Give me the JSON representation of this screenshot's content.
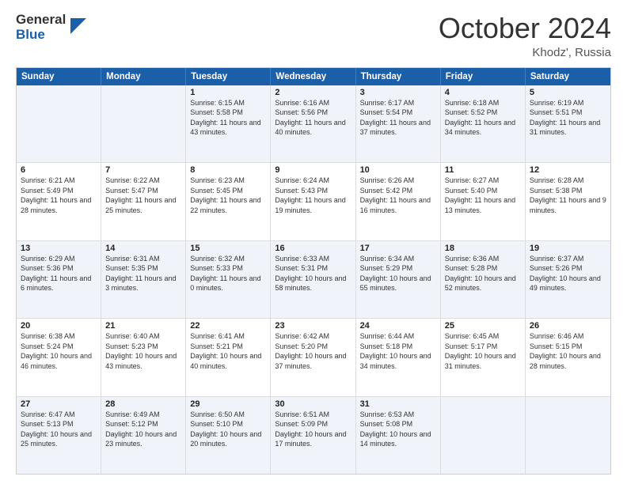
{
  "logo": {
    "line1": "General",
    "line2": "Blue"
  },
  "title": "October 2024",
  "location": "Khodz', Russia",
  "days": [
    "Sunday",
    "Monday",
    "Tuesday",
    "Wednesday",
    "Thursday",
    "Friday",
    "Saturday"
  ],
  "rows": [
    [
      {
        "day": "",
        "sunrise": "",
        "sunset": "",
        "daylight": "",
        "empty": true
      },
      {
        "day": "",
        "sunrise": "",
        "sunset": "",
        "daylight": "",
        "empty": true
      },
      {
        "day": "1",
        "sunrise": "Sunrise: 6:15 AM",
        "sunset": "Sunset: 5:58 PM",
        "daylight": "Daylight: 11 hours and 43 minutes."
      },
      {
        "day": "2",
        "sunrise": "Sunrise: 6:16 AM",
        "sunset": "Sunset: 5:56 PM",
        "daylight": "Daylight: 11 hours and 40 minutes."
      },
      {
        "day": "3",
        "sunrise": "Sunrise: 6:17 AM",
        "sunset": "Sunset: 5:54 PM",
        "daylight": "Daylight: 11 hours and 37 minutes."
      },
      {
        "day": "4",
        "sunrise": "Sunrise: 6:18 AM",
        "sunset": "Sunset: 5:52 PM",
        "daylight": "Daylight: 11 hours and 34 minutes."
      },
      {
        "day": "5",
        "sunrise": "Sunrise: 6:19 AM",
        "sunset": "Sunset: 5:51 PM",
        "daylight": "Daylight: 11 hours and 31 minutes."
      }
    ],
    [
      {
        "day": "6",
        "sunrise": "Sunrise: 6:21 AM",
        "sunset": "Sunset: 5:49 PM",
        "daylight": "Daylight: 11 hours and 28 minutes."
      },
      {
        "day": "7",
        "sunrise": "Sunrise: 6:22 AM",
        "sunset": "Sunset: 5:47 PM",
        "daylight": "Daylight: 11 hours and 25 minutes."
      },
      {
        "day": "8",
        "sunrise": "Sunrise: 6:23 AM",
        "sunset": "Sunset: 5:45 PM",
        "daylight": "Daylight: 11 hours and 22 minutes."
      },
      {
        "day": "9",
        "sunrise": "Sunrise: 6:24 AM",
        "sunset": "Sunset: 5:43 PM",
        "daylight": "Daylight: 11 hours and 19 minutes."
      },
      {
        "day": "10",
        "sunrise": "Sunrise: 6:26 AM",
        "sunset": "Sunset: 5:42 PM",
        "daylight": "Daylight: 11 hours and 16 minutes."
      },
      {
        "day": "11",
        "sunrise": "Sunrise: 6:27 AM",
        "sunset": "Sunset: 5:40 PM",
        "daylight": "Daylight: 11 hours and 13 minutes."
      },
      {
        "day": "12",
        "sunrise": "Sunrise: 6:28 AM",
        "sunset": "Sunset: 5:38 PM",
        "daylight": "Daylight: 11 hours and 9 minutes."
      }
    ],
    [
      {
        "day": "13",
        "sunrise": "Sunrise: 6:29 AM",
        "sunset": "Sunset: 5:36 PM",
        "daylight": "Daylight: 11 hours and 6 minutes."
      },
      {
        "day": "14",
        "sunrise": "Sunrise: 6:31 AM",
        "sunset": "Sunset: 5:35 PM",
        "daylight": "Daylight: 11 hours and 3 minutes."
      },
      {
        "day": "15",
        "sunrise": "Sunrise: 6:32 AM",
        "sunset": "Sunset: 5:33 PM",
        "daylight": "Daylight: 11 hours and 0 minutes."
      },
      {
        "day": "16",
        "sunrise": "Sunrise: 6:33 AM",
        "sunset": "Sunset: 5:31 PM",
        "daylight": "Daylight: 10 hours and 58 minutes."
      },
      {
        "day": "17",
        "sunrise": "Sunrise: 6:34 AM",
        "sunset": "Sunset: 5:29 PM",
        "daylight": "Daylight: 10 hours and 55 minutes."
      },
      {
        "day": "18",
        "sunrise": "Sunrise: 6:36 AM",
        "sunset": "Sunset: 5:28 PM",
        "daylight": "Daylight: 10 hours and 52 minutes."
      },
      {
        "day": "19",
        "sunrise": "Sunrise: 6:37 AM",
        "sunset": "Sunset: 5:26 PM",
        "daylight": "Daylight: 10 hours and 49 minutes."
      }
    ],
    [
      {
        "day": "20",
        "sunrise": "Sunrise: 6:38 AM",
        "sunset": "Sunset: 5:24 PM",
        "daylight": "Daylight: 10 hours and 46 minutes."
      },
      {
        "day": "21",
        "sunrise": "Sunrise: 6:40 AM",
        "sunset": "Sunset: 5:23 PM",
        "daylight": "Daylight: 10 hours and 43 minutes."
      },
      {
        "day": "22",
        "sunrise": "Sunrise: 6:41 AM",
        "sunset": "Sunset: 5:21 PM",
        "daylight": "Daylight: 10 hours and 40 minutes."
      },
      {
        "day": "23",
        "sunrise": "Sunrise: 6:42 AM",
        "sunset": "Sunset: 5:20 PM",
        "daylight": "Daylight: 10 hours and 37 minutes."
      },
      {
        "day": "24",
        "sunrise": "Sunrise: 6:44 AM",
        "sunset": "Sunset: 5:18 PM",
        "daylight": "Daylight: 10 hours and 34 minutes."
      },
      {
        "day": "25",
        "sunrise": "Sunrise: 6:45 AM",
        "sunset": "Sunset: 5:17 PM",
        "daylight": "Daylight: 10 hours and 31 minutes."
      },
      {
        "day": "26",
        "sunrise": "Sunrise: 6:46 AM",
        "sunset": "Sunset: 5:15 PM",
        "daylight": "Daylight: 10 hours and 28 minutes."
      }
    ],
    [
      {
        "day": "27",
        "sunrise": "Sunrise: 6:47 AM",
        "sunset": "Sunset: 5:13 PM",
        "daylight": "Daylight: 10 hours and 25 minutes."
      },
      {
        "day": "28",
        "sunrise": "Sunrise: 6:49 AM",
        "sunset": "Sunset: 5:12 PM",
        "daylight": "Daylight: 10 hours and 23 minutes."
      },
      {
        "day": "29",
        "sunrise": "Sunrise: 6:50 AM",
        "sunset": "Sunset: 5:10 PM",
        "daylight": "Daylight: 10 hours and 20 minutes."
      },
      {
        "day": "30",
        "sunrise": "Sunrise: 6:51 AM",
        "sunset": "Sunset: 5:09 PM",
        "daylight": "Daylight: 10 hours and 17 minutes."
      },
      {
        "day": "31",
        "sunrise": "Sunrise: 6:53 AM",
        "sunset": "Sunset: 5:08 PM",
        "daylight": "Daylight: 10 hours and 14 minutes."
      },
      {
        "day": "",
        "sunrise": "",
        "sunset": "",
        "daylight": "",
        "empty": true
      },
      {
        "day": "",
        "sunrise": "",
        "sunset": "",
        "daylight": "",
        "empty": true
      }
    ]
  ],
  "alt_rows": [
    0,
    2,
    4
  ]
}
